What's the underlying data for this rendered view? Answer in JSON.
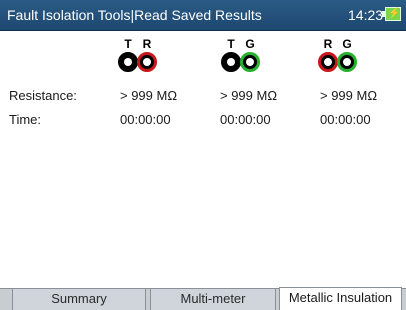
{
  "header": {
    "title": "Fault Isolation Tools|Read Saved Results",
    "time": "14:23",
    "battery_icon": "battery-charging-icon"
  },
  "probes": [
    {
      "a": "T",
      "b": "R",
      "a_color": "#000000",
      "b_color": "#c8161d"
    },
    {
      "a": "T",
      "b": "G",
      "a_color": "#000000",
      "b_color": "#27b02f"
    },
    {
      "a": "R",
      "b": "G",
      "a_color": "#c8161d",
      "b_color": "#27b02f"
    }
  ],
  "results": {
    "resistance_label": "Resistance:",
    "time_label": "Time:",
    "resistance": [
      "> 999 MΩ",
      "> 999 MΩ",
      "> 999 MΩ"
    ],
    "time": [
      "00:00:00",
      "00:00:00",
      "00:00:00"
    ]
  },
  "tabs": [
    {
      "label": "Summary",
      "active": false
    },
    {
      "label": "Multi-meter",
      "active": false
    },
    {
      "label": "Metallic Insulation",
      "active": true
    }
  ]
}
